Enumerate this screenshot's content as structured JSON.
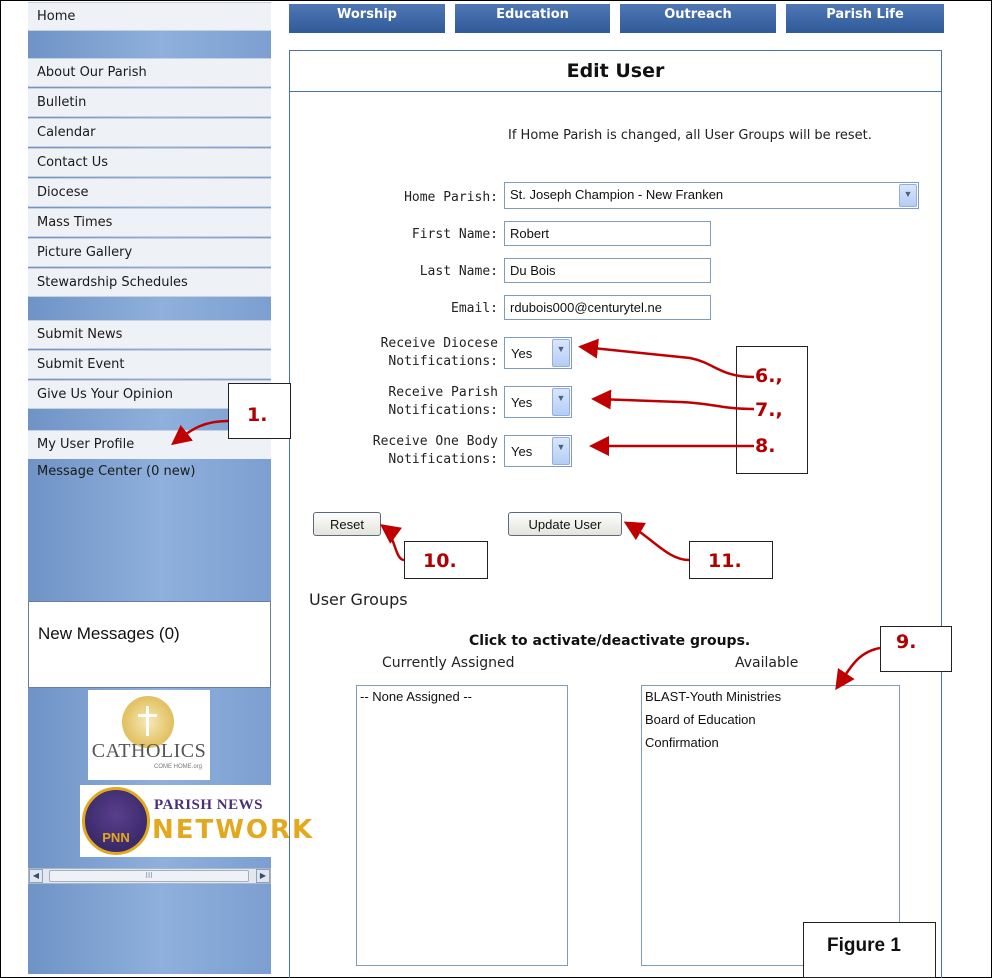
{
  "sidebar": {
    "items": [
      {
        "label": "Home"
      },
      {
        "label": "About Our Parish"
      },
      {
        "label": "Bulletin"
      },
      {
        "label": "Calendar"
      },
      {
        "label": "Contact Us"
      },
      {
        "label": "Diocese"
      },
      {
        "label": "Mass Times"
      },
      {
        "label": "Picture Gallery"
      },
      {
        "label": "Stewardship Schedules"
      },
      {
        "label": "Submit News"
      },
      {
        "label": "Submit Event"
      },
      {
        "label": "Give Us Your Opinion"
      },
      {
        "label": "My User Profile"
      },
      {
        "label": "Message Center (0 new)"
      }
    ],
    "new_messages": "New Messages (0)",
    "logo_catholics": {
      "word": "CATHOLICS",
      "sub": "COME HOME.org"
    },
    "logo_pnn": {
      "line1": "PARISH NEWS",
      "line2": "NETWORK",
      "badge": "PNN"
    },
    "scroll_thumb": "III"
  },
  "topnav": {
    "tabs": [
      "Worship",
      "Education",
      "Outreach",
      "Parish Life"
    ]
  },
  "page": {
    "title": "Edit User"
  },
  "form": {
    "note": "If Home Parish is changed, all User Groups will be reset.",
    "home_parish": {
      "label": "Home Parish:",
      "value": "St. Joseph Champion - New Franken"
    },
    "first_name": {
      "label": "First Name:",
      "value": "Robert"
    },
    "last_name": {
      "label": "Last Name:",
      "value": "Du Bois"
    },
    "email": {
      "label": "Email:",
      "value": "rdubois000@centurytel.ne"
    },
    "diocese": {
      "label1": "Receive Diocese",
      "label2": "Notifications:",
      "value": "Yes"
    },
    "parish": {
      "label1": "Receive Parish",
      "label2": "Notifications:",
      "value": "Yes"
    },
    "onebody": {
      "label1": "Receive One Body",
      "label2": "Notifications:",
      "value": "Yes"
    },
    "reset_label": "Reset",
    "update_label": "Update User"
  },
  "groups": {
    "title": "User Groups",
    "hint": "Click to activate/deactivate groups.",
    "assigned_header": "Currently Assigned",
    "available_header": "Available",
    "assigned": [
      "-- None Assigned --"
    ],
    "available": [
      "BLAST-Youth Ministries",
      "Board of Education",
      "Confirmation"
    ]
  },
  "callouts": {
    "c1": "1.",
    "c6": "6.,",
    "c7": "7.,",
    "c8": "8.",
    "c9": "9.",
    "c10": "10.",
    "c11": "11."
  },
  "figure_label": "Figure 1",
  "colors": {
    "nav_blue": "#2f5a98",
    "sidebar_blue": "#7c9fd1",
    "callout_red": "#b00000"
  }
}
